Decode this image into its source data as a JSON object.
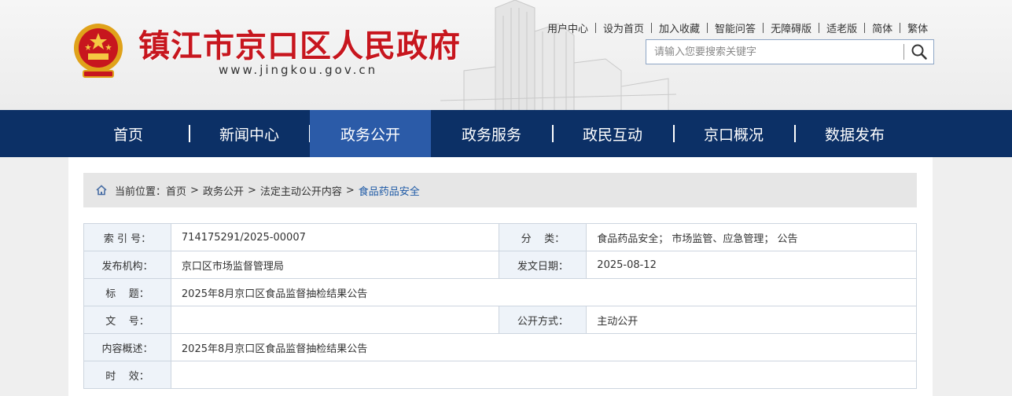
{
  "header": {
    "site_name": "镇江市京口区人民政府",
    "site_url": "www.jingkou.gov.cn"
  },
  "toplinks": [
    "用户中心",
    "设为首页",
    "加入收藏",
    "智能问答",
    "无障碍版",
    "适老版",
    "简体",
    "繁体"
  ],
  "search": {
    "placeholder": "请输入您要搜索关键字",
    "icon": "search-icon"
  },
  "nav": {
    "items": [
      "首页",
      "新闻中心",
      "政务公开",
      "政务服务",
      "政民互动",
      "京口概况",
      "数据发布"
    ],
    "active": "政务公开"
  },
  "breadcrumb": {
    "prefix": "当前位置：",
    "items": [
      "首页",
      "政务公开",
      "法定主动公开内容"
    ],
    "current": "食品药品安全",
    "separator": ">"
  },
  "info": {
    "index_label": "索 引 号：",
    "index_value": "714175291/2025-00007",
    "category_label": "分    类：",
    "category_value": "食品药品安全； 市场监管、应急管理； 公告",
    "publisher_label": "发布机构：",
    "publisher_value": "京口区市场监督管理局",
    "date_label": "发文日期：",
    "date_value": "2025-08-12",
    "title_label": "标    题：",
    "title_value": "2025年8月京口区食品监督抽检结果公告",
    "docno_label": "文    号：",
    "docno_value": "",
    "disclosure_label": "公开方式：",
    "disclosure_value": "主动公开",
    "summary_label": "内容概述：",
    "summary_value": "2025年8月京口区食品监督抽检结果公告",
    "validity_label": "时    效：",
    "validity_value": ""
  },
  "colors": {
    "brand_red": "#c7161e",
    "nav_bg": "#0c3066",
    "nav_active": "#2b5ba8",
    "breadcrumb_current": "#1e5aa6"
  }
}
